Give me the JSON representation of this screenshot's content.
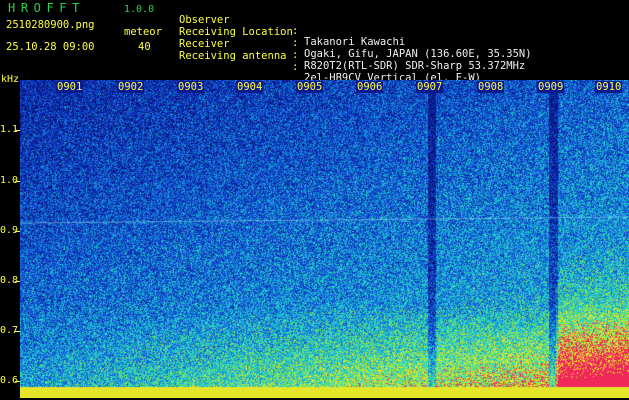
{
  "header": {
    "app_title": "HROFFT",
    "app_version": "1.0.0",
    "filename": "2510280900.png",
    "timestamp": "25.10.28 09:00",
    "mode_label": "meteor",
    "mode_count": "40"
  },
  "metadata": [
    {
      "key": "Observer",
      "value": "Takanori Kawachi"
    },
    {
      "key": "Receiving Location",
      "value": "Ogaki, Gifu, JAPAN (136.60E, 35.35N)"
    },
    {
      "key": "Receiver",
      "value": "R820T2(RTL-SDR) SDR-Sharp 53.372MHz"
    },
    {
      "key": "Receiving antenna",
      "value": "2el-HB9CV Vertical (el. E-W)"
    }
  ],
  "separator": ":",
  "axis": {
    "y_unit": "kHz",
    "y_ticks": [
      "1.1",
      "1.0",
      "0.9",
      "0.8",
      "0.7",
      "0.6"
    ],
    "x_ticks": [
      "0901",
      "0902",
      "0903",
      "0904",
      "0905",
      "0906",
      "0907",
      "0908",
      "0909",
      "0910"
    ]
  },
  "colors": {
    "background": "#000000",
    "title_green": "#2ad14b",
    "label_yellow": "#ffff40",
    "value_white": "#f0f0f0",
    "plot_base": "#0b1a8c"
  }
}
